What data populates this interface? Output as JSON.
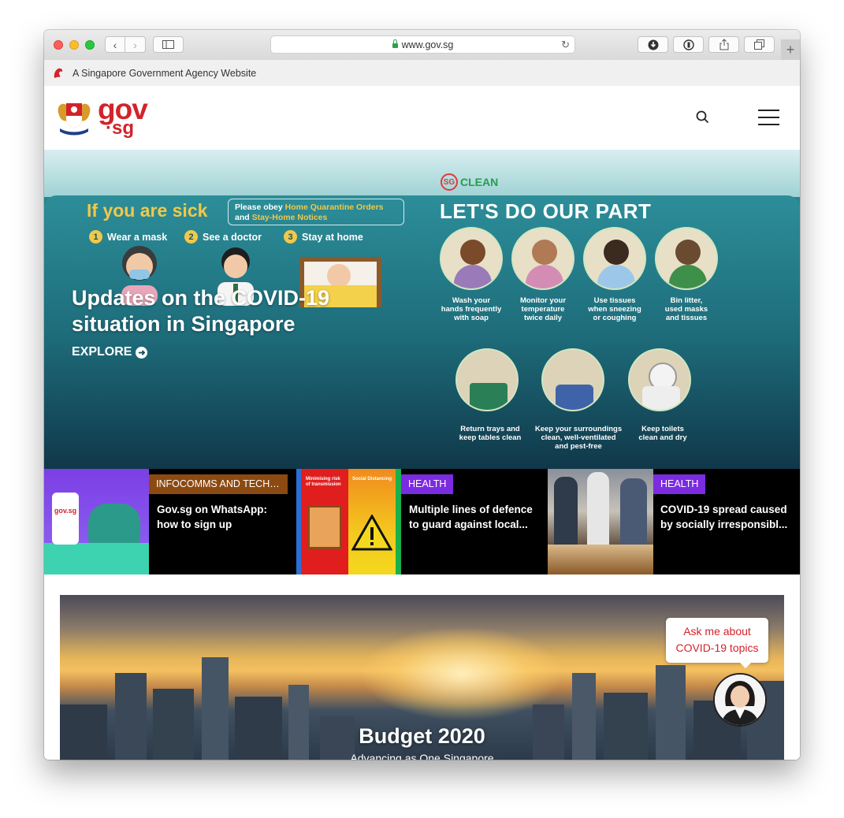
{
  "browser": {
    "url": "www.gov.sg",
    "colors": {
      "close": "#fc5f57",
      "minimize": "#fdbc2e",
      "maximize": "#28c840"
    }
  },
  "gov_banner": {
    "text": "A Singapore Government Agency Website"
  },
  "header": {
    "logo_top": "gov",
    "logo_bottom": "sg",
    "brand_color": "#d2232a"
  },
  "hero": {
    "title_line1": "Updates on the COVID-19",
    "title_line2": "situation in Singapore",
    "explore_label": "EXPLORE",
    "poster": {
      "sick_heading": "If you are sick",
      "obey_prefix": "Please obey ",
      "obey_highlight1": "Home Quarantine Orders",
      "obey_mid": "and ",
      "obey_highlight2": "Stay-Home Notices",
      "steps": [
        {
          "num": "1",
          "label": "Wear a mask"
        },
        {
          "num": "2",
          "label": "See a doctor"
        },
        {
          "num": "3",
          "label": "Stay at home"
        }
      ],
      "sgclean_badge": "SG",
      "sgclean_label": "CLEAN",
      "part_heading": "LET'S DO OUR PART",
      "tips_row1": [
        {
          "l1": "Wash your",
          "l2": "hands frequently",
          "l3": "with soap"
        },
        {
          "l1": "Monitor your",
          "l2": "temperature",
          "l3": "twice daily"
        },
        {
          "l1": "Use tissues",
          "l2": "when sneezing",
          "l3": "or coughing"
        },
        {
          "l1": "Bin litter,",
          "l2": "used masks",
          "l3": "and tissues"
        }
      ],
      "tips_row2": [
        {
          "l1": "Return trays and",
          "l2": "keep tables clean",
          "l3": ""
        },
        {
          "l1": "Keep your surroundings",
          "l2": "clean, well-ventilated",
          "l3": "and pest-free"
        },
        {
          "l1": "Keep toilets",
          "l2": "clean and dry",
          "l3": ""
        }
      ]
    }
  },
  "cards": [
    {
      "tag": "INFOCOMMS AND TECHN...",
      "tag_color": "#8b4a12",
      "line1": "Gov.sg on WhatsApp:",
      "line2": "how to sign up",
      "thumb_text": "gov.sg"
    },
    {
      "tag": "HEALTH",
      "tag_color": "#7b2be0",
      "line1": "Multiple lines of defence",
      "line2": "to guard against local...",
      "thumb_left": "Minimising risk of transmission",
      "thumb_right": "Social Distancing"
    },
    {
      "tag": "HEALTH",
      "tag_color": "#7b2be0",
      "line1": "COVID-19 spread caused",
      "line2": "by socially irresponsibl..."
    }
  ],
  "budget": {
    "title": "Budget 2020",
    "subtitle": "Advancing as One Singapore"
  },
  "chatbot": {
    "line1": "Ask me about",
    "line2": "COVID-19 topics"
  }
}
